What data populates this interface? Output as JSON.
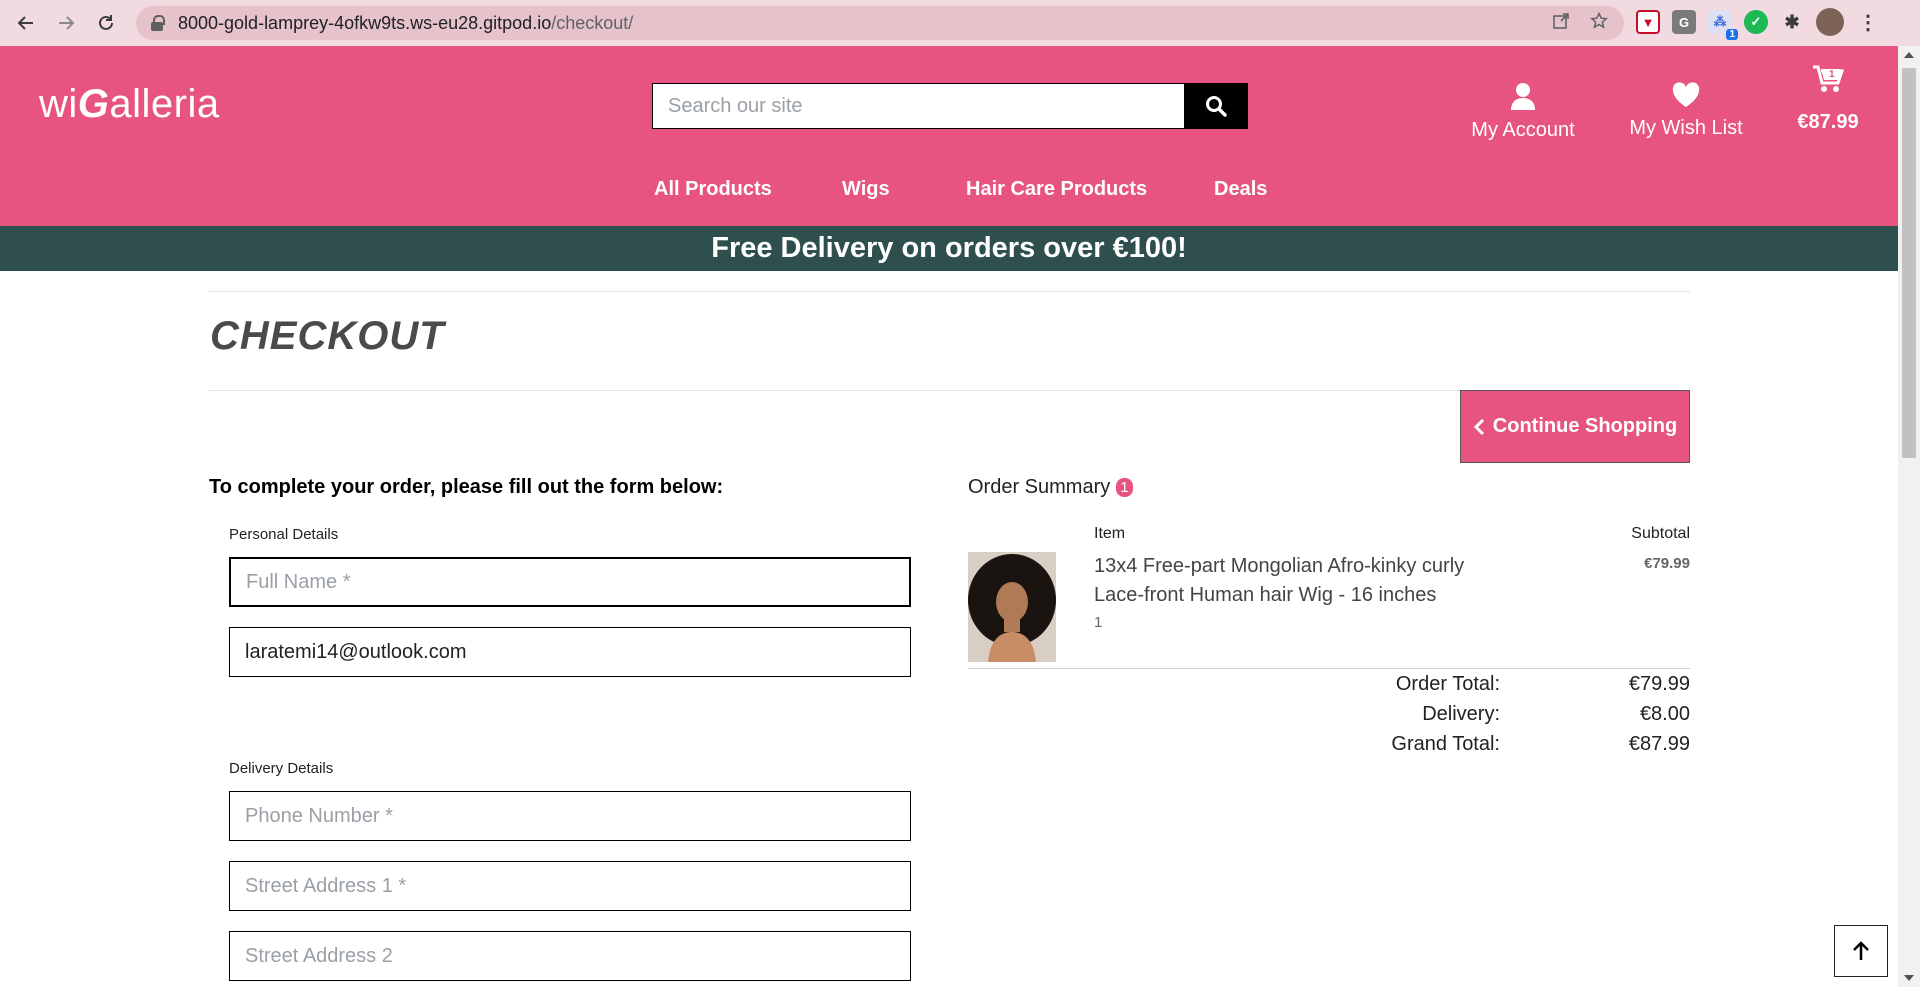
{
  "browser": {
    "url_host": "8000-gold-lamprey-4ofkw9ts.ws-eu28.gitpod.io",
    "url_path": "/checkout/",
    "extension_badge": "1"
  },
  "header": {
    "logo_prefix": "wi",
    "logo_g": "G",
    "logo_suffix": "alleria",
    "search_placeholder": "Search our site",
    "account_label": "My Account",
    "wishlist_label": "My Wish List",
    "cart_total": "€87.99",
    "cart_count": "1",
    "brand_color": "#e75480"
  },
  "nav": {
    "items": [
      "All Products",
      "Wigs",
      "Hair Care Products",
      "Deals"
    ]
  },
  "banner": {
    "text": "Free Delivery on orders over €100!",
    "color": "#2f4f4f"
  },
  "page": {
    "title": "CHECKOUT",
    "continue_label": "Continue Shopping",
    "intro": "To complete your order, please fill out the form below:"
  },
  "form": {
    "personal_label": "Personal Details",
    "full_name_placeholder": "Full Name *",
    "email_value": "laratemi14@outlook.com",
    "delivery_label": "Delivery Details",
    "phone_placeholder": "Phone Number *",
    "street1_placeholder": "Street Address 1 *",
    "street2_placeholder": "Street Address 2"
  },
  "summary": {
    "title": "Order Summary",
    "count": "1",
    "item_header": "Item",
    "subtotal_header": "Subtotal",
    "item_name": "13x4 Free-part Mongolian Afro-kinky curly Lace-front Human hair Wig - 16 inches",
    "item_qty": "1",
    "item_price": "€79.99",
    "order_total_label": "Order Total:",
    "order_total": "€79.99",
    "delivery_label": "Delivery:",
    "delivery": "€8.00",
    "grand_total_label": "Grand Total:",
    "grand_total": "€87.99"
  }
}
